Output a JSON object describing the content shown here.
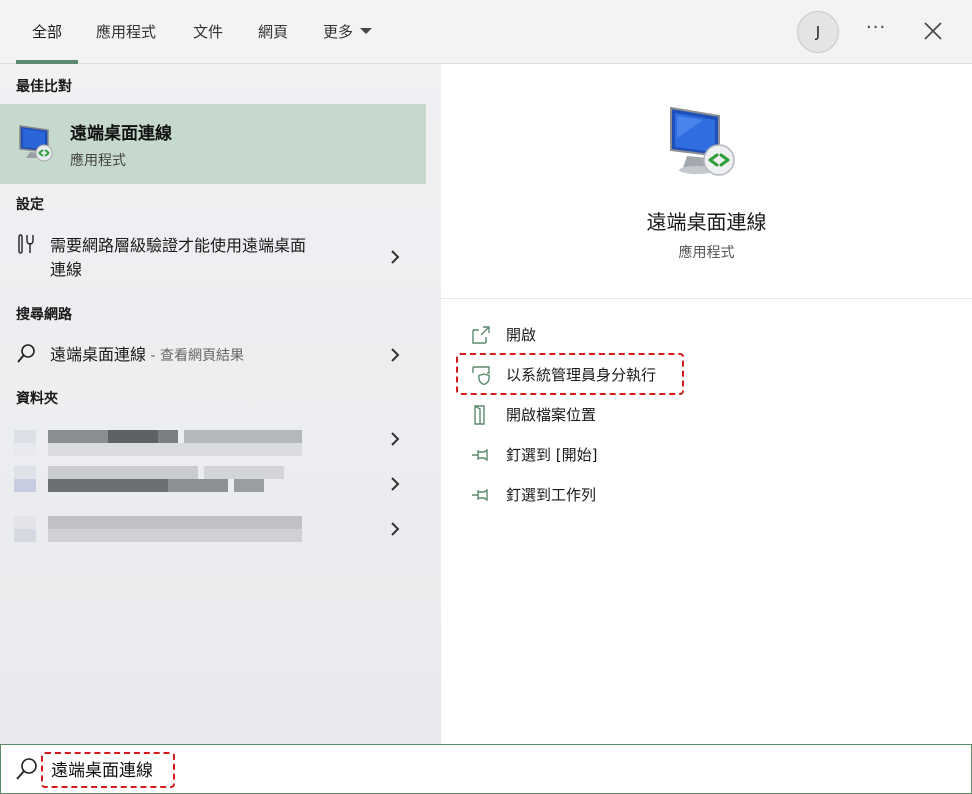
{
  "tabs": [
    {
      "label": "全部"
    },
    {
      "label": "應用程式"
    },
    {
      "label": "文件"
    },
    {
      "label": "網頁"
    },
    {
      "label": "更多"
    }
  ],
  "user_initial": "J",
  "more_options_glyph": "···",
  "left": {
    "best_match_heading": "最佳比對",
    "best_match": {
      "title": "遠端桌面連線",
      "subtitle": "應用程式",
      "icon": "remote-desktop-icon"
    },
    "settings_heading": "設定",
    "settings_item": {
      "line1": "需要網路層級驗證才能使用遠端桌面",
      "line2": "連線",
      "icon": "settings-wrench-icon"
    },
    "web_heading": "搜尋網路",
    "web_item": {
      "query": "遠端桌面連線",
      "suffix": " - 查看網頁結果",
      "icon": "search-icon"
    },
    "folders_heading": "資料夾",
    "folders_count_visible": 3
  },
  "right": {
    "app_name": "遠端桌面連線",
    "app_type": "應用程式",
    "actions": [
      {
        "label": "開啟",
        "icon": "open-external-icon"
      },
      {
        "label": "以系統管理員身分執行",
        "icon": "shield-icon"
      },
      {
        "label": "開啟檔案位置",
        "icon": "file-location-icon"
      },
      {
        "label": "釘選到 [開始]",
        "icon": "pin-icon"
      },
      {
        "label": "釘選到工作列",
        "icon": "pin-icon"
      }
    ]
  },
  "search": {
    "value": "遠端桌面連線"
  },
  "colors": {
    "accent": "#5b8a6e",
    "highlight": "#c5d9cd",
    "annotation": "#d41a1a"
  }
}
